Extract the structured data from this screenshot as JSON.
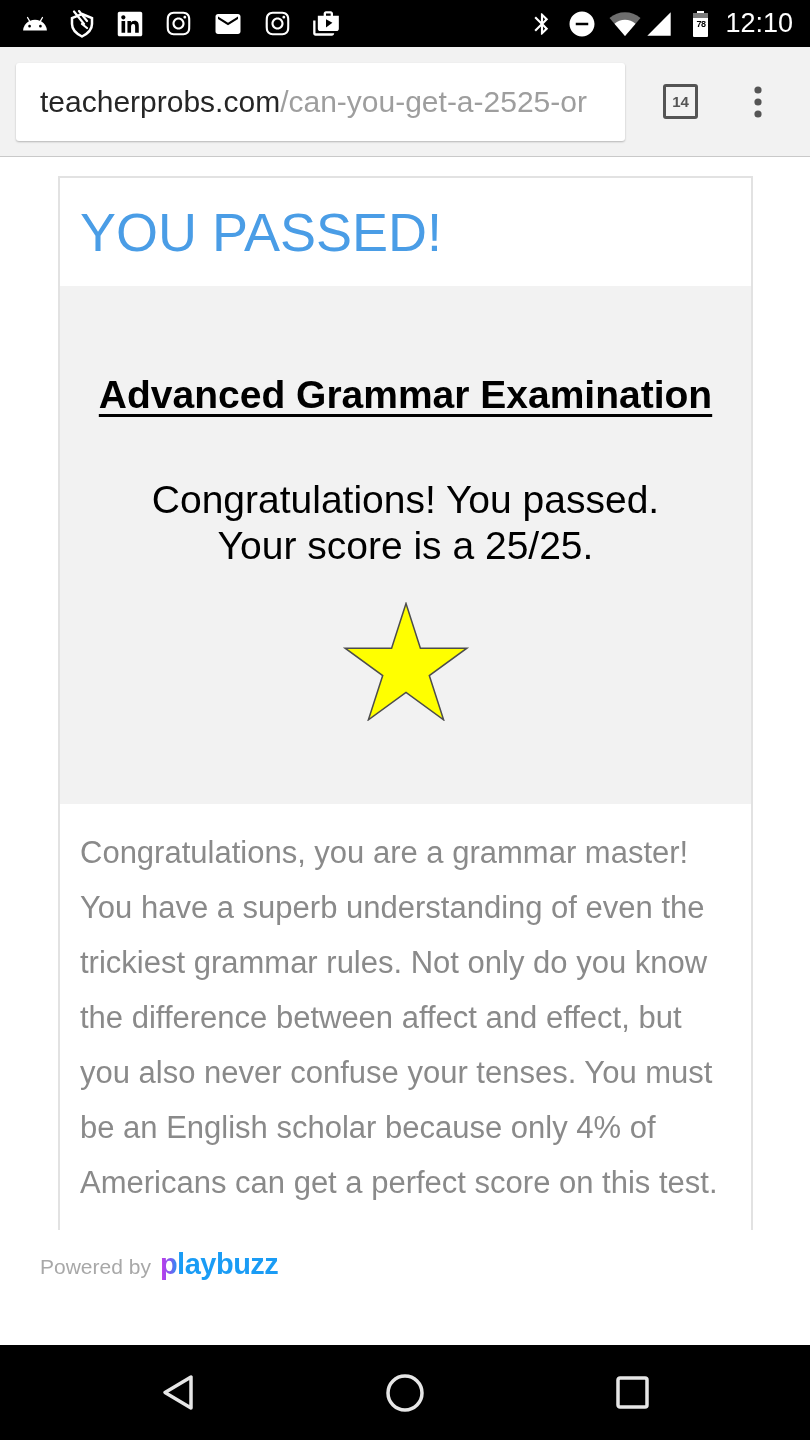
{
  "status_bar": {
    "battery": "78",
    "time": "12:10"
  },
  "browser": {
    "url_domain": "teacherprobs.com",
    "url_path": "/can-you-get-a-2525-or",
    "tab_count": "14"
  },
  "result": {
    "heading": "YOU PASSED!",
    "image": {
      "title": "Advanced Grammar Examination",
      "message": "Congratulations! You passed. Your score is a 25/25."
    },
    "description": "Congratulations, you are a grammar master! You have a superb understanding of even the trickiest grammar rules. Not only do you know the difference between affect and effect, but you also never confuse your tenses. You must be an English scholar because only 4% of Americans can get a perfect score on this test."
  },
  "footer": {
    "powered_by": "Powered by",
    "brand": "playbuzz"
  }
}
